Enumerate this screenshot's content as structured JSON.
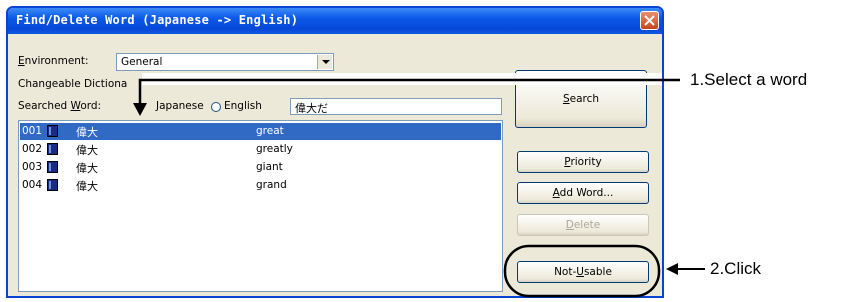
{
  "window": {
    "title": "Find/Delete Word (Japanese -> English)"
  },
  "environment": {
    "label_first": "E",
    "label_rest": "nvironment:",
    "value": "General"
  },
  "changeable_dictionary": {
    "label": "Changeable Dictiona"
  },
  "searched_word": {
    "label_first": "Searched ",
    "label_u": "W",
    "label_rest": "ord:",
    "radio_japanese": "Japanese",
    "radio_english": "English",
    "value": "偉大だ"
  },
  "results": [
    {
      "num": "001",
      "jp": "偉大",
      "en": "great",
      "selected": true
    },
    {
      "num": "002",
      "jp": "偉大",
      "en": "greatly",
      "selected": false
    },
    {
      "num": "003",
      "jp": "偉大",
      "en": "giant",
      "selected": false
    },
    {
      "num": "004",
      "jp": "偉大",
      "en": "grand",
      "selected": false
    }
  ],
  "buttons": {
    "search": {
      "u": "S",
      "rest": "earch"
    },
    "priority": {
      "u": "P",
      "rest": "riority"
    },
    "add_word": {
      "u": "A",
      "rest": "dd Word..."
    },
    "delete": {
      "u": "D",
      "rest": "elete"
    },
    "not_usable": {
      "first": "Not-",
      "u": "U",
      "rest": "sable"
    }
  },
  "annotations": {
    "step1": "1.Select a word",
    "step2": "2.Click"
  }
}
